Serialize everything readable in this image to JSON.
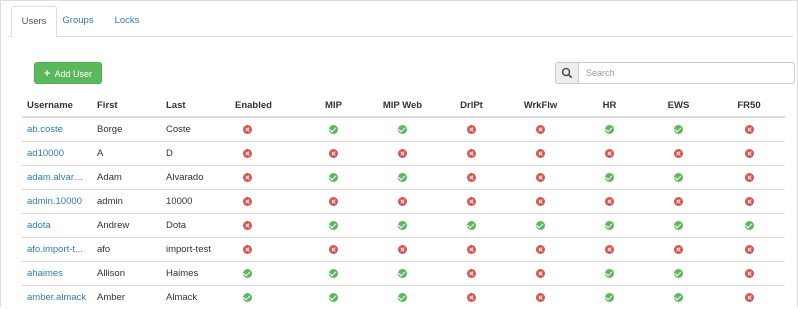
{
  "tabs": [
    {
      "label": "Users",
      "active": true
    },
    {
      "label": "Groups",
      "active": false
    },
    {
      "label": "Locks",
      "active": false
    }
  ],
  "toolbar": {
    "add_user_label": "Add User",
    "add_icon": "plus-icon",
    "search_icon": "magnifier-icon",
    "search_placeholder": "Search",
    "search_value": ""
  },
  "colors": {
    "accent": "#337ab7",
    "success": "#5cb85c",
    "danger": "#d9534f"
  },
  "table": {
    "columns": [
      "Username",
      "First",
      "Last",
      "Enabled",
      "MIP",
      "MIP Web",
      "DrlPt",
      "WrkFlw",
      "HR",
      "EWS",
      "FR50"
    ],
    "rows": [
      {
        "username": "ab.coste",
        "first": "Borge",
        "last": "Coste",
        "flags": [
          false,
          true,
          true,
          false,
          false,
          true,
          true,
          false
        ]
      },
      {
        "username": "ad10000",
        "first": "A",
        "last": "D",
        "flags": [
          false,
          false,
          false,
          false,
          false,
          false,
          false,
          false
        ]
      },
      {
        "username": "adam.alvarado",
        "first": "Adam",
        "last": "Alvarado",
        "flags": [
          false,
          true,
          true,
          false,
          false,
          true,
          true,
          false
        ]
      },
      {
        "username": "admin.10000",
        "first": "admin",
        "last": "10000",
        "flags": [
          false,
          false,
          false,
          false,
          false,
          false,
          false,
          false
        ]
      },
      {
        "username": "adota",
        "first": "Andrew",
        "last": "Dota",
        "flags": [
          false,
          true,
          true,
          true,
          true,
          true,
          true,
          true
        ]
      },
      {
        "username": "afo.import-t...",
        "first": "afo",
        "last": "import-test",
        "flags": [
          false,
          false,
          false,
          false,
          false,
          false,
          false,
          false
        ]
      },
      {
        "username": "ahaimes",
        "first": "Allison",
        "last": "Haimes",
        "flags": [
          true,
          true,
          true,
          false,
          false,
          true,
          true,
          false
        ]
      },
      {
        "username": "amber.almack",
        "first": "Amber",
        "last": "Almack",
        "flags": [
          true,
          true,
          true,
          false,
          false,
          true,
          true,
          false
        ]
      }
    ]
  }
}
